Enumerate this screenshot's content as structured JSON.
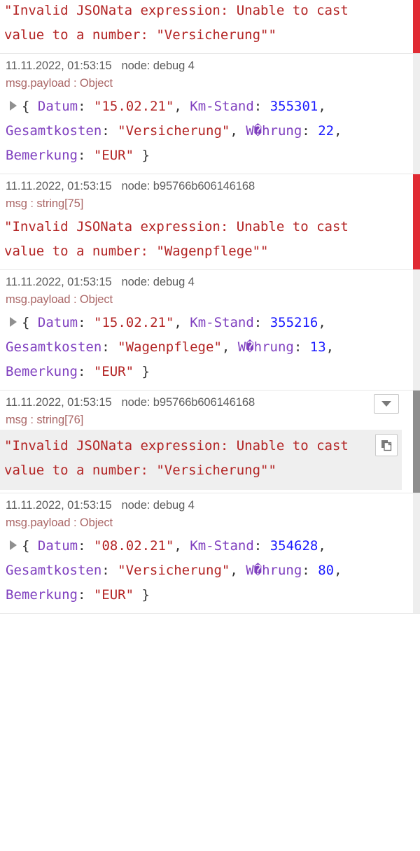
{
  "panel": {
    "name": "node-red-debug-sidebar",
    "colors": {
      "error_text": "#b32424",
      "object_key": "#7f3fbf",
      "string_value": "#b32424",
      "number_value": "#1a1aff",
      "timestamp": "#5c5c5c",
      "topic_label": "#aa6666",
      "status_error": "#e02b33",
      "status_normal": "#eeeeee",
      "status_hover": "#8e8e8e",
      "highlight_bg": "#efefef"
    }
  },
  "messages": [
    {
      "id": "msg-0",
      "level": "error",
      "clipped_top": true,
      "has_header": false,
      "timestamp": "",
      "node": "",
      "topic": "",
      "body_type": "string",
      "text": "\"Invalid JSONata expression: Unable to cast value to a number: \"Versicherung\"\""
    },
    {
      "id": "msg-1",
      "level": "normal",
      "clipped_top": false,
      "has_header": true,
      "timestamp": "11.11.2022, 01:53:15",
      "node": "node: debug 4",
      "topic": "msg.payload : Object",
      "body_type": "object",
      "object": {
        "open_brace": "{",
        "close_brace": "}",
        "entries": [
          {
            "key": "Datum",
            "value": "\"15.02.21\"",
            "type": "string"
          },
          {
            "key": "Km-Stand",
            "value": "355301",
            "type": "number"
          },
          {
            "key": "Gesamtkosten",
            "value": "\"Versicherung\"",
            "type": "string"
          },
          {
            "key": "W�hrung",
            "value": "22",
            "type": "number"
          },
          {
            "key": "Bemerkung",
            "value": "\"EUR\"",
            "type": "string"
          }
        ]
      }
    },
    {
      "id": "msg-2",
      "level": "error",
      "clipped_top": false,
      "has_header": true,
      "timestamp": "11.11.2022, 01:53:15",
      "node": "node: b95766b606146168",
      "topic": "msg : string[75]",
      "body_type": "string",
      "text": "\"Invalid JSONata expression: Unable to cast value to a number: \"Wagenpflege\"\""
    },
    {
      "id": "msg-3",
      "level": "normal",
      "clipped_top": false,
      "has_header": true,
      "timestamp": "11.11.2022, 01:53:15",
      "node": "node: debug 4",
      "topic": "msg.payload : Object",
      "body_type": "object",
      "object": {
        "open_brace": "{",
        "close_brace": "}",
        "entries": [
          {
            "key": "Datum",
            "value": "\"15.02.21\"",
            "type": "string"
          },
          {
            "key": "Km-Stand",
            "value": "355216",
            "type": "number"
          },
          {
            "key": "Gesamtkosten",
            "value": "\"Wagenpflege\"",
            "type": "string"
          },
          {
            "key": "W�hrung",
            "value": "13",
            "type": "number"
          },
          {
            "key": "Bemerkung",
            "value": "\"EUR\"",
            "type": "string"
          }
        ]
      }
    },
    {
      "id": "msg-4",
      "level": "hover",
      "clipped_top": false,
      "has_header": true,
      "hovered": true,
      "timestamp": "11.11.2022, 01:53:15",
      "node": "node: b95766b606146168",
      "topic": "msg : string[76]",
      "body_type": "string",
      "highlighted": true,
      "menu_button_icon": "chevron-down-icon",
      "copy_button_icon": "copy-icon",
      "text": "\"Invalid JSONata expression: Unable to cast value to a number: \"Versicherung\"\""
    },
    {
      "id": "msg-5",
      "level": "normal",
      "clipped_top": false,
      "has_header": true,
      "timestamp": "11.11.2022, 01:53:15",
      "node": "node: debug 4",
      "topic": "msg.payload : Object",
      "body_type": "object",
      "object": {
        "open_brace": "{",
        "close_brace": "}",
        "entries": [
          {
            "key": "Datum",
            "value": "\"08.02.21\"",
            "type": "string"
          },
          {
            "key": "Km-Stand",
            "value": "354628",
            "type": "number"
          },
          {
            "key": "Gesamtkosten",
            "value": "\"Versicherung\"",
            "type": "string"
          },
          {
            "key": "W�hrung",
            "value": "80",
            "type": "number"
          },
          {
            "key": "Bemerkung",
            "value": "\"EUR\"",
            "type": "string"
          }
        ]
      }
    }
  ]
}
